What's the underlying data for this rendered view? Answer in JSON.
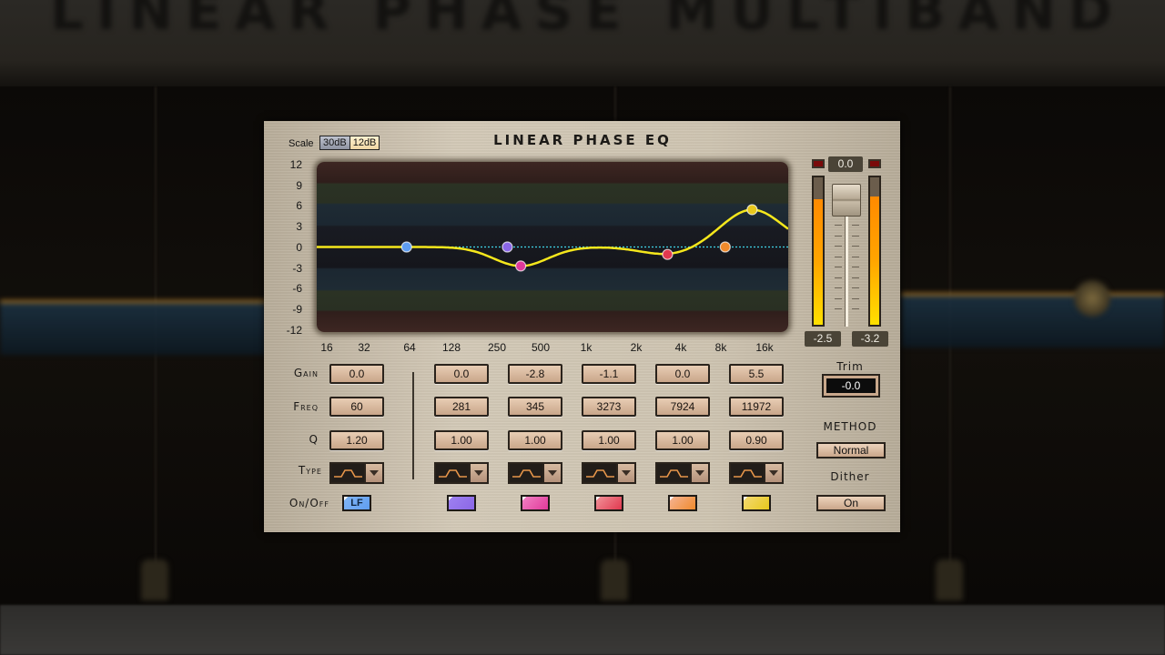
{
  "background": {
    "title": "LINEAR PHASE MULTIBAND"
  },
  "plugin": {
    "title": "LINEAR PHASE EQ",
    "scale": {
      "label": "Scale",
      "options": [
        "30dB",
        "12dB"
      ],
      "selected": "12dB"
    }
  },
  "graph": {
    "y_ticks": [
      "12",
      "9",
      "6",
      "3",
      "0",
      "-3",
      "-6",
      "-9",
      "-12"
    ],
    "x_ticks": [
      "16",
      "32",
      "64",
      "128",
      "250",
      "500",
      "1k",
      "2k",
      "4k",
      "8k",
      "16k"
    ],
    "y_range_db": [
      -12,
      12
    ],
    "curve_color": "#f5e71c",
    "zero_line_color": "#3fd3e8"
  },
  "params": {
    "labels": {
      "gain": "Gain",
      "freq": "Freq",
      "q": "Q",
      "type": "Type",
      "onoff": "On/Off"
    },
    "bands": [
      {
        "id": "LF",
        "gain": "0.0",
        "freq": "60",
        "q": "1.20",
        "label": "LF",
        "color": "#5e9cf0",
        "on_color": "#7fb4f5"
      },
      {
        "id": "band1",
        "gain": "0.0",
        "freq": "281",
        "q": "1.00",
        "label": "",
        "color": "#8a66e6",
        "on_color": "#9d7ff0"
      },
      {
        "id": "band2",
        "gain": "-2.8",
        "freq": "345",
        "q": "1.00",
        "label": "",
        "color": "#e0399a",
        "on_color": "#f07ac0"
      },
      {
        "id": "band3",
        "gain": "-1.1",
        "freq": "3273",
        "q": "1.00",
        "label": "",
        "color": "#e0384f",
        "on_color": "#f08a92"
      },
      {
        "id": "band4",
        "gain": "0.0",
        "freq": "7924",
        "q": "1.00",
        "label": "",
        "color": "#f08a2c",
        "on_color": "#f5b08a"
      },
      {
        "id": "band5",
        "gain": "5.5",
        "freq": "11972",
        "q": "0.90",
        "label": "",
        "color": "#e8c81c",
        "on_color": "#f3d86a"
      }
    ]
  },
  "output": {
    "master_readout": "0.0",
    "left_readout": "-2.5",
    "right_readout": "-3.2",
    "left_level": 0.85,
    "right_level": 0.87,
    "trim_label": "Trim",
    "trim_value": "-0.0",
    "method_label": "METHOD",
    "method_value": "Normal",
    "dither_label": "Dither",
    "dither_value": "On"
  }
}
